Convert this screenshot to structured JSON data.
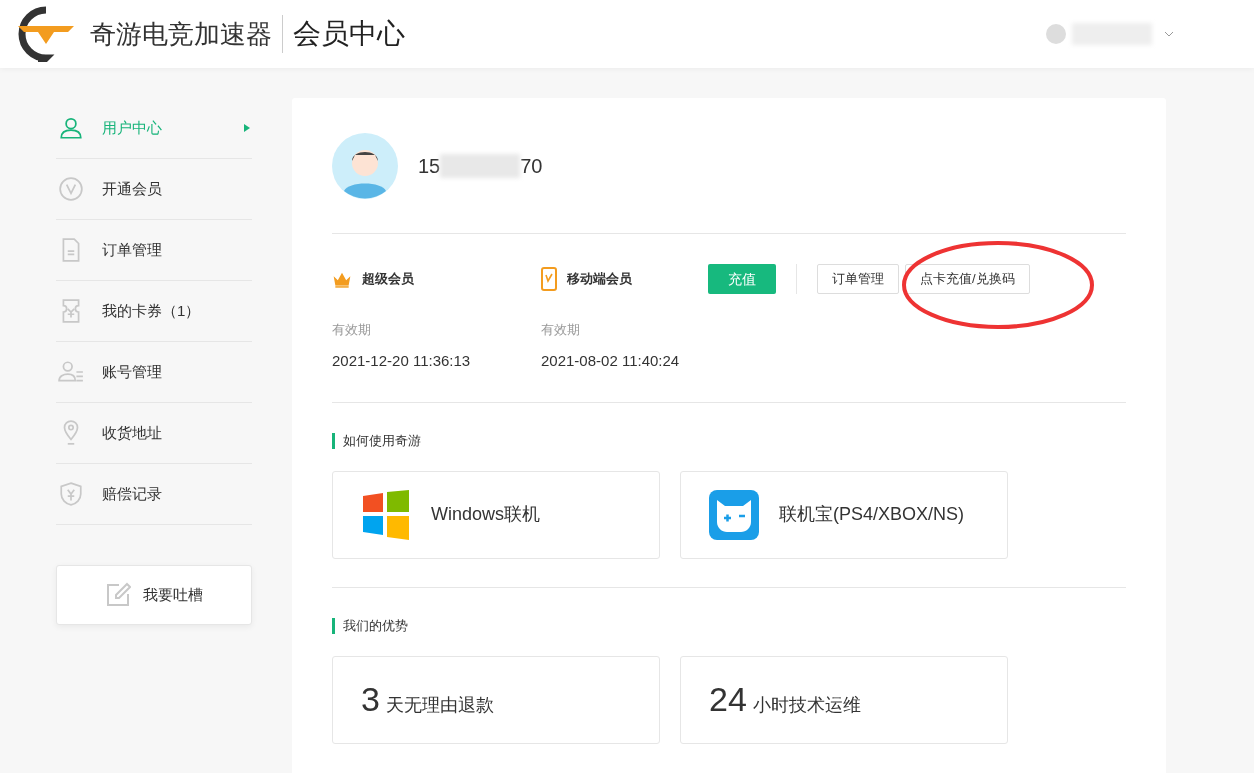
{
  "header": {
    "brand": "奇游电竞加速器",
    "section": "会员中心"
  },
  "sidebar": {
    "items": [
      {
        "label": "用户中心",
        "kind": "user",
        "selected": true
      },
      {
        "label": "开通会员",
        "kind": "v",
        "selected": false
      },
      {
        "label": "订单管理",
        "kind": "doc",
        "selected": false
      },
      {
        "label": "我的卡券（1）",
        "kind": "ticket",
        "selected": false
      },
      {
        "label": "账号管理",
        "kind": "account",
        "selected": false
      },
      {
        "label": "收货地址",
        "kind": "pin",
        "selected": false
      },
      {
        "label": "赔偿记录",
        "kind": "shield",
        "selected": false
      }
    ],
    "feedback_button": "我要吐槽"
  },
  "profile": {
    "phone_start": "15",
    "phone_end": "70"
  },
  "memberships": [
    {
      "name": "超级会员",
      "kind": "crown",
      "validity_label": "有效期",
      "expiry": "2021-12-20 11:36:13"
    },
    {
      "name": "移动端会员",
      "kind": "phone",
      "validity_label": "有效期",
      "expiry": "2021-08-02 11:40:24"
    }
  ],
  "buttons": [
    {
      "label": "充值",
      "kind": "primary"
    },
    {
      "label": "订单管理",
      "kind": "outline"
    },
    {
      "label": "点卡充值/兑换码",
      "kind": "outline"
    }
  ],
  "how_to": {
    "title": "如何使用奇游",
    "cards": [
      {
        "label": "Windows联机",
        "kind": "windows"
      },
      {
        "label": "联机宝(PS4/XBOX/NS)",
        "kind": "gamepad"
      }
    ]
  },
  "advantages": {
    "title": "我们的优势",
    "cards": [
      {
        "number": "3",
        "label": "天无理由退款"
      },
      {
        "number": "24",
        "label": "小时技术运维"
      }
    ]
  }
}
